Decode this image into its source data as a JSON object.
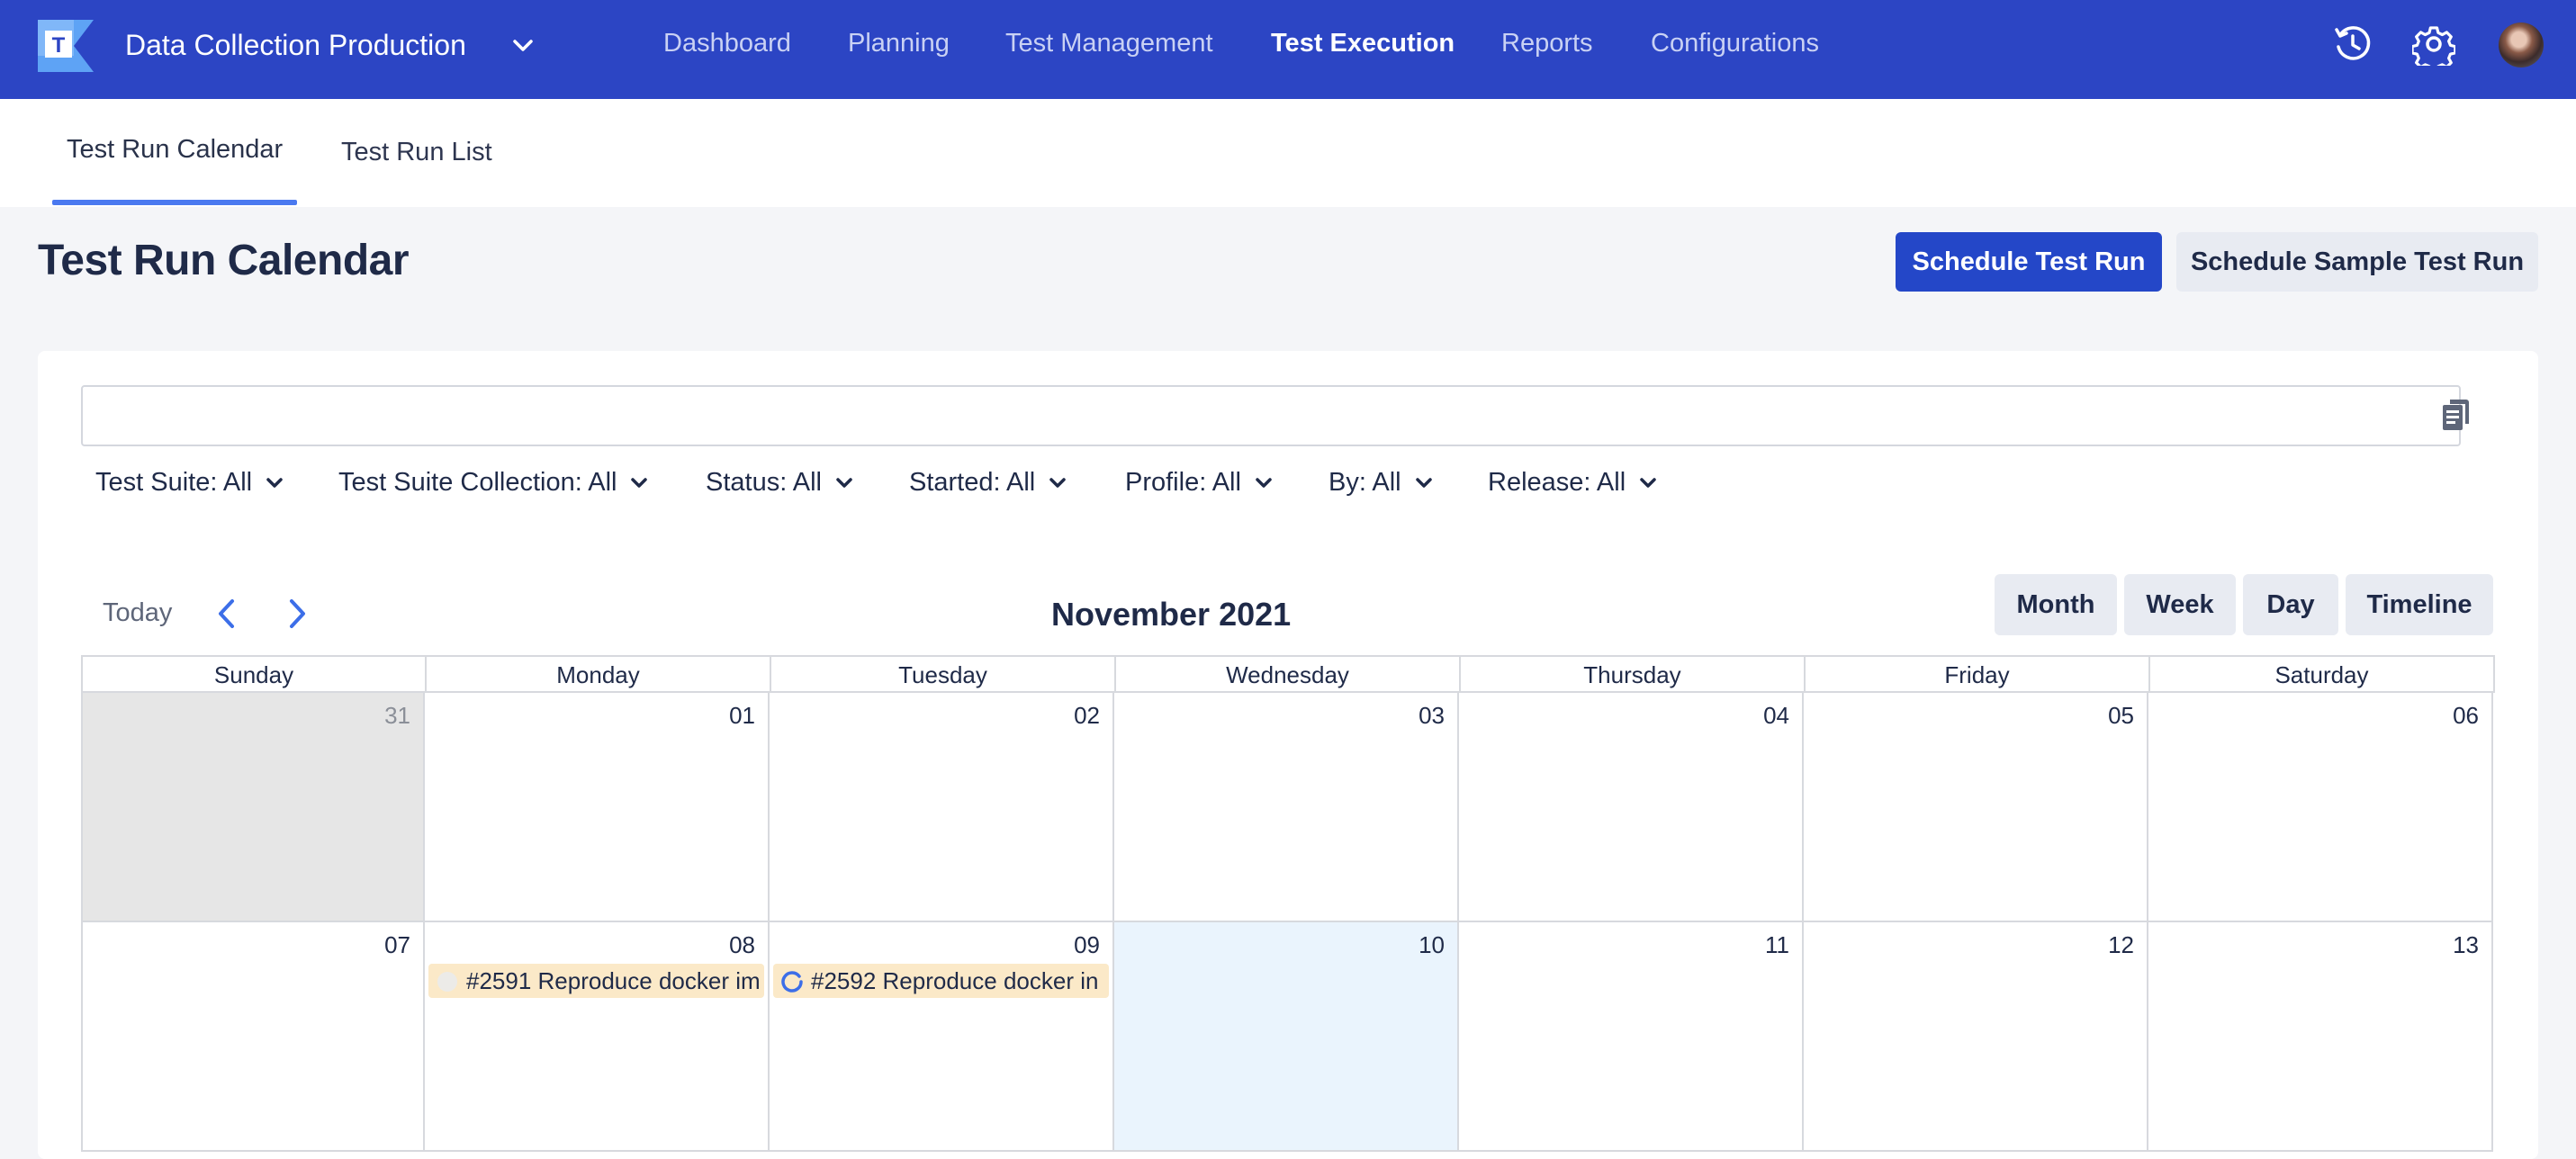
{
  "header": {
    "project_name": "Data Collection Production",
    "nav": [
      "Dashboard",
      "Planning",
      "Test Management",
      "Test Execution",
      "Reports",
      "Configurations"
    ],
    "active_nav": "Test Execution",
    "accent_color": "#2c45c4"
  },
  "subtabs": [
    "Test Run Calendar",
    "Test Run List"
  ],
  "page": {
    "title": "Test Run Calendar",
    "primary_button": "Schedule Test Run",
    "secondary_button": "Schedule Sample Test Run"
  },
  "search": {
    "value": "",
    "placeholder": ""
  },
  "filters": [
    "Test Suite: All",
    "Test Suite Collection: All",
    "Status: All",
    "Started: All",
    "Profile: All",
    "By: All",
    "Release: All"
  ],
  "calendar": {
    "today_label": "Today",
    "month_title": "November 2021",
    "views": [
      "Month",
      "Week",
      "Day",
      "Timeline"
    ],
    "weekdays": [
      "Sunday",
      "Monday",
      "Tuesday",
      "Wednesday",
      "Thursday",
      "Friday",
      "Saturday"
    ],
    "weeks": [
      [
        "31",
        "01",
        "02",
        "03",
        "04",
        "05",
        "06"
      ],
      [
        "07",
        "08",
        "09",
        "10",
        "11",
        "12",
        "13"
      ]
    ],
    "events": {
      "mon": "#2591 Reproduce docker im",
      "tue": "#2592 Reproduce docker in"
    },
    "event_color": "#fbe9c8",
    "today_color": "#eaf4fd"
  }
}
